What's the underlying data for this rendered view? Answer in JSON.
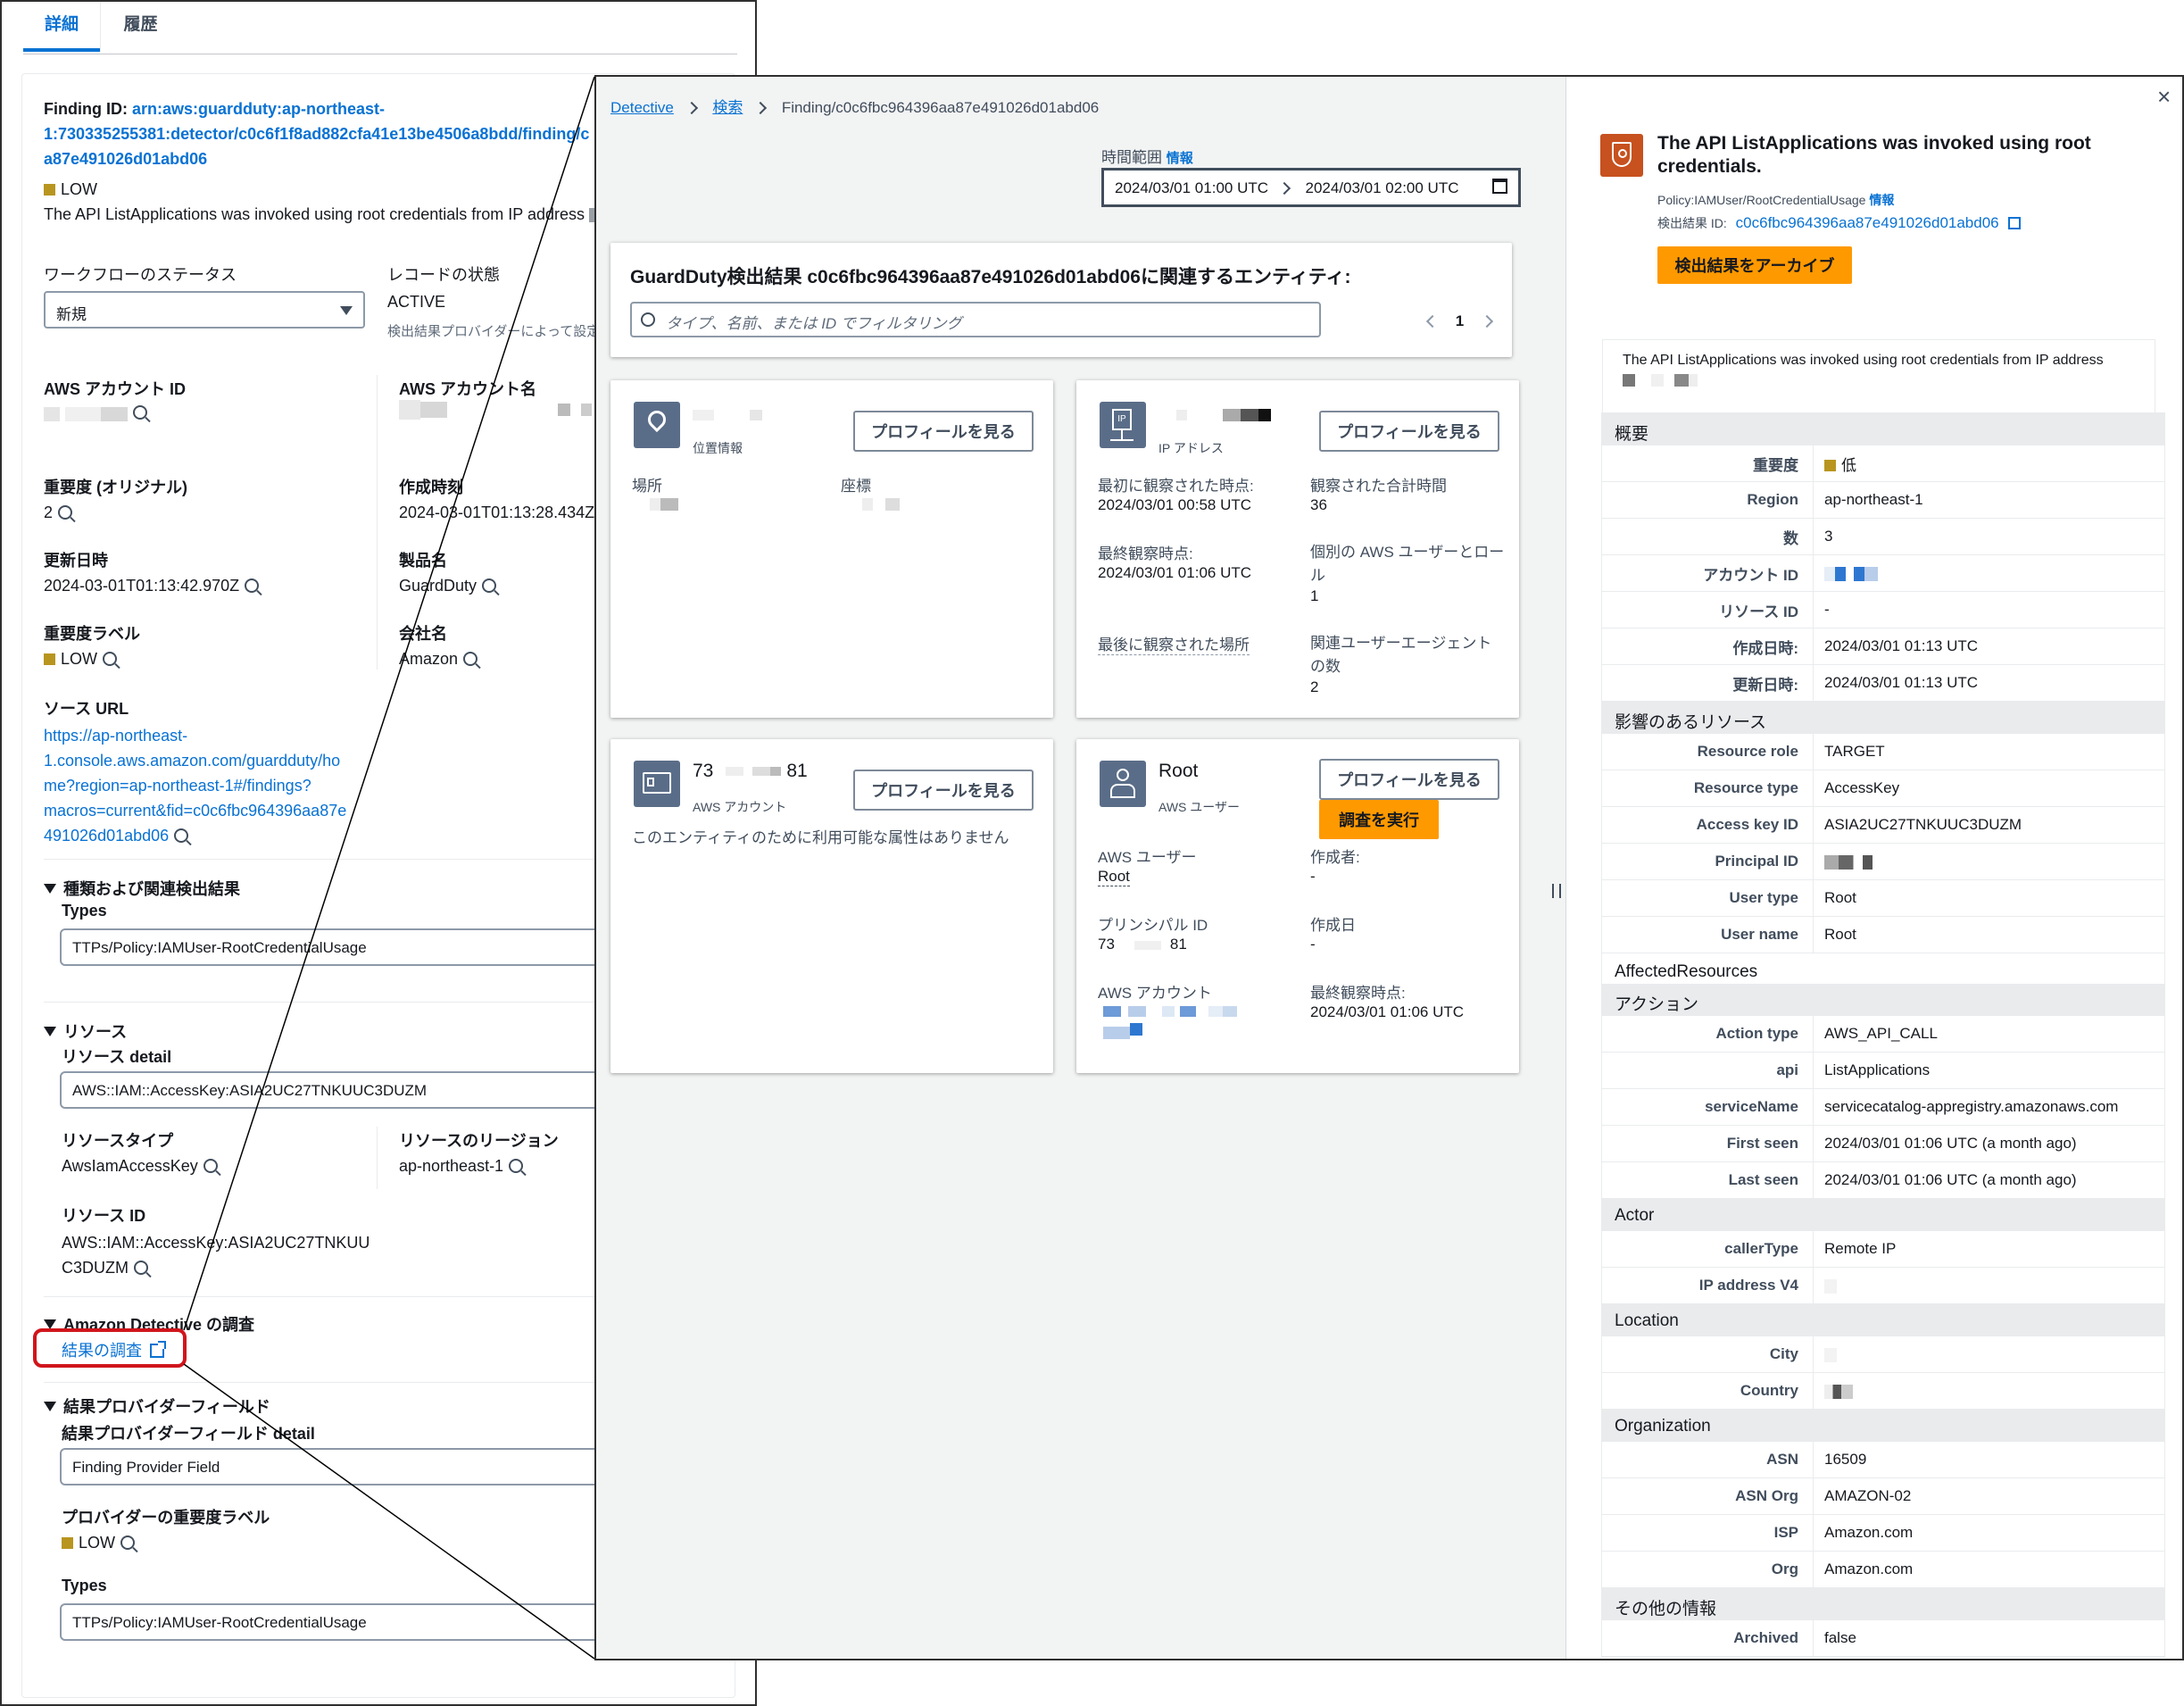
{
  "left": {
    "tabs": [
      "詳細",
      "履歴"
    ],
    "finding_id_label": "Finding ID:",
    "finding_id_lines": [
      "arn:aws:guardduty:ap-northeast-",
      "1:730335255381:detector/c0c6f1f8ad882cfa41e13be4506a8bdd/finding/c",
      "a87e491026d01abd06"
    ],
    "severity_badge": "LOW",
    "description": "The API ListApplications was invoked using root credentials from IP address",
    "workflow_label": "ワークフローのステータス",
    "workflow_value": "新規",
    "record_label": "レコードの状態",
    "record_value": "ACTIVE",
    "record_note": "検出結果プロバイダーによって設定",
    "account_id_label": "AWS アカウント ID",
    "account_name_label": "AWS アカウント名",
    "severity_orig_label": "重要度 (オリジナル)",
    "severity_orig_value": "2",
    "created_label": "作成時刻",
    "created_value": "2024-03-01T01:13:28.434Z",
    "updated_label": "更新日時",
    "updated_value": "2024-03-01T01:13:42.970Z",
    "product_label": "製品名",
    "product_value": "GuardDuty",
    "sevlabel_label": "重要度ラベル",
    "sevlabel_value": "LOW",
    "company_label": "会社名",
    "company_value": "Amazon",
    "source_url_label": "ソース URL",
    "source_url_lines": [
      "https://ap-northeast-",
      "1.console.aws.amazon.com/guardduty/ho",
      "me?region=ap-northeast-1#/findings?",
      "macros=current&fid=c0c6fbc964396aa87e",
      "491026d01abd06"
    ],
    "types_section": "種類および関連検出結果",
    "types_label": "Types",
    "types_value": "TTPs/Policy:IAMUser-RootCredentialUsage",
    "resources_section": "リソース",
    "resource_detail_label": "リソース detail",
    "resource_detail_value": "AWS::IAM::AccessKey:ASIA2UC27TNKUUC3DUZM",
    "resource_type_label": "リソースタイプ",
    "resource_type_value": "AwsIamAccessKey",
    "resource_region_label": "リソースのリージョン",
    "resource_region_value": "ap-northeast-1",
    "resource_id_label": "リソース ID",
    "resource_id_lines": [
      "AWS::IAM::AccessKey:ASIA2UC27TNKUU",
      "C3DUZM"
    ],
    "detective_section": "Amazon Detective の調査",
    "investigate_link": "結果の調査",
    "provider_section": "結果プロバイダーフィールド",
    "provider_detail_label": "結果プロバイダーフィールド detail",
    "provider_detail_value": "Finding Provider Field",
    "provider_sev_label": "プロバイダーの重要度ラベル",
    "provider_sev_value": "LOW",
    "provider_types_label": "Types",
    "provider_types_value": "TTPs/Policy:IAMUser-RootCredentialUsage"
  },
  "detective": {
    "breadcrumb": [
      "Detective",
      "検索",
      "Finding/c0c6fbc964396aa87e491026d01abd06"
    ],
    "time_range_label": "時間範囲",
    "info": "情報",
    "time_start": "2024/03/01 01:00 UTC",
    "time_end": "2024/03/01 02:00 UTC",
    "entities_title": "GuardDuty検出結果 c0c6fbc964396aa87e491026d01abd06に関連するエンティティ:",
    "filter_placeholder": "タイプ、名前、または ID でフィルタリング",
    "page_number": "1",
    "profile_btn": "プロフィールを見る",
    "investigate_btn": "調査を実行",
    "geo": {
      "subtitle": "位置情報",
      "place_label": "場所",
      "coord_label": "座標"
    },
    "ip": {
      "subtitle": "IP アドレス",
      "first_label": "最初に観察された時点:",
      "first_value": "2024/03/01 00:58 UTC",
      "total_label": "観察された合計時間",
      "total_value": "36",
      "last_label": "最終観察時点:",
      "last_value": "2024/03/01 01:06 UTC",
      "users_label_1": "個別の AWS ユーザーとロー",
      "users_label_2": "ル",
      "users_value": "1",
      "lastplace_label": "最後に観察された場所",
      "ua_label_1": "関連ユーザーエージェント",
      "ua_label_2": "の数",
      "ua_value": "2"
    },
    "account": {
      "name_start": "73",
      "name_end": "81",
      "subtitle": "AWS アカウント",
      "empty_text": "このエンティティのために利用可能な属性はありません"
    },
    "user": {
      "name": "Root",
      "subtitle": "AWS ユーザー",
      "user_label": "AWS ユーザー",
      "user_value": "Root",
      "creator_label": "作成者:",
      "creator_value": "-",
      "principal_label": "プリンシパル ID",
      "principal_start": "73",
      "principal_end": "81",
      "created_label": "作成日",
      "created_value": "-",
      "account_label": "AWS アカウント",
      "lastseen_label": "最終観察時点:",
      "lastseen_value": "2024/03/01 01:06 UTC"
    }
  },
  "panel": {
    "title_1": "The API ListApplications was invoked using root",
    "title_2": "credentials.",
    "type": "Policy:IAMUser/RootCredentialUsage",
    "info": "情報",
    "finding_id_label": "検出結果 ID:",
    "finding_id_value": "c0c6fbc964396aa87e491026d01abd06",
    "archive_btn": "検出結果をアーカイブ",
    "description": "The API ListApplications was invoked using root credentials from IP address",
    "sec_overview": "概要",
    "overview": [
      [
        "重要度",
        "低"
      ],
      [
        "Region",
        "ap-northeast-1"
      ],
      [
        "数",
        "3"
      ],
      [
        "アカウント ID",
        ""
      ],
      [
        "リソース ID",
        "-"
      ],
      [
        "作成日時:",
        "2024/03/01 01:13 UTC"
      ],
      [
        "更新日時:",
        "2024/03/01 01:13 UTC"
      ]
    ],
    "sec_resources": "影響のあるリソース",
    "resources": [
      [
        "Resource role",
        "TARGET"
      ],
      [
        "Resource type",
        "AccessKey"
      ],
      [
        "Access key ID",
        "ASIA2UC27TNKUUC3DUZM"
      ],
      [
        "Principal ID",
        ""
      ],
      [
        "User type",
        "Root"
      ],
      [
        "User name",
        "Root"
      ]
    ],
    "affected": "AffectedResources",
    "sec_action": "アクション",
    "action": [
      [
        "Action type",
        "AWS_API_CALL"
      ],
      [
        "api",
        "ListApplications"
      ],
      [
        "serviceName",
        "servicecatalog-appregistry.amazonaws.com"
      ],
      [
        "First seen",
        "2024/03/01 01:06 UTC (a month ago)"
      ],
      [
        "Last seen",
        "2024/03/01 01:06 UTC (a month ago)"
      ]
    ],
    "sec_actor": "Actor",
    "actor": [
      [
        "callerType",
        "Remote IP"
      ],
      [
        "IP address V4",
        ""
      ]
    ],
    "sec_location": "Location",
    "location": [
      [
        "City",
        ""
      ],
      [
        "Country",
        ""
      ]
    ],
    "sec_org": "Organization",
    "org": [
      [
        "ASN",
        "16509"
      ],
      [
        "ASN Org",
        "AMAZON-02"
      ],
      [
        "ISP",
        "Amazon.com"
      ],
      [
        "Org",
        "Amazon.com"
      ]
    ],
    "sec_other": "その他の情報",
    "other": [
      [
        "Archived",
        "false"
      ]
    ]
  },
  "colors": {
    "link": "#0972d3",
    "orange": "#ff9900",
    "low": "#b8951f",
    "highlight": "#d0151c"
  }
}
